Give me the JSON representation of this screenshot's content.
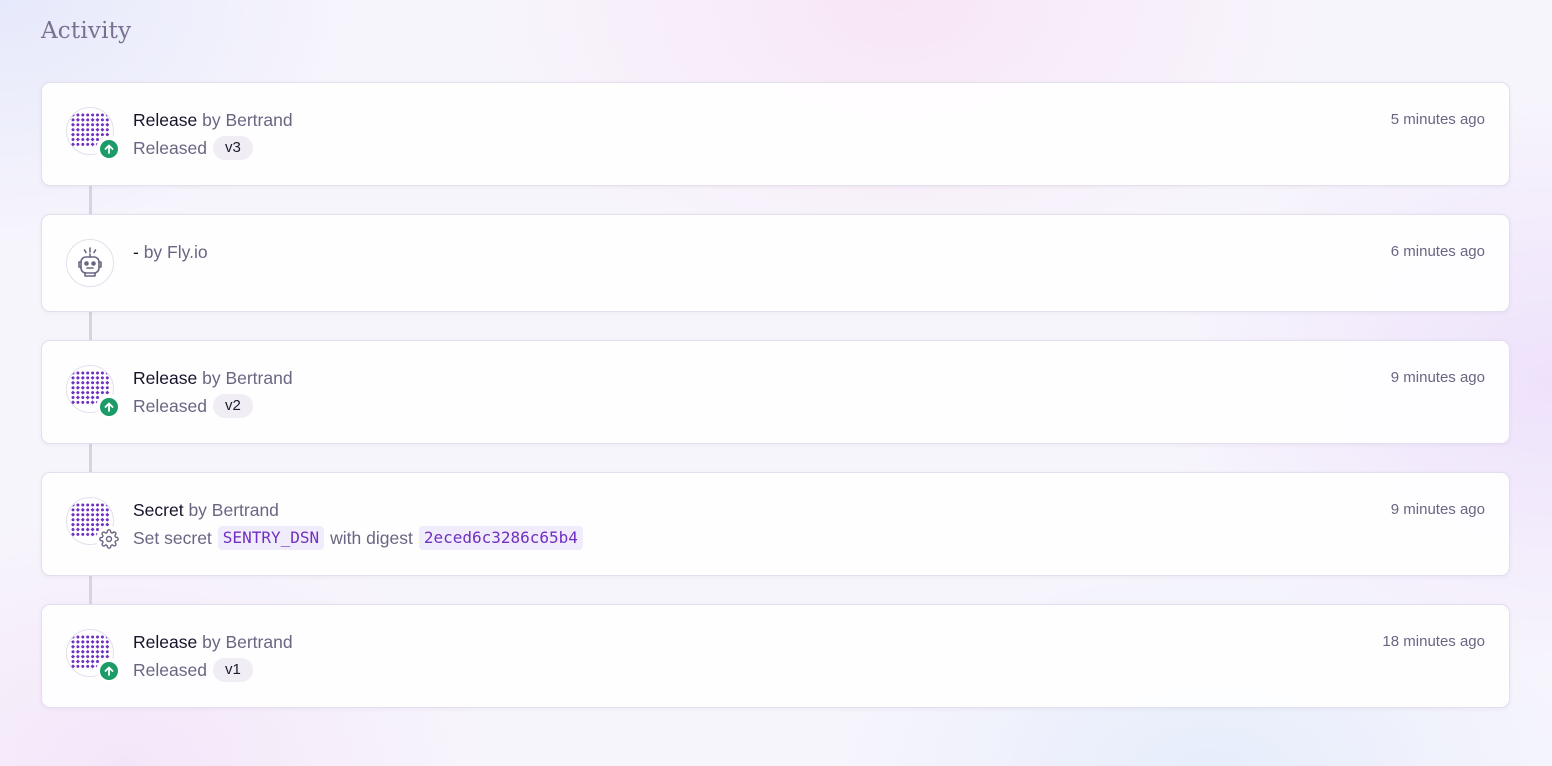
{
  "page": {
    "title": "Activity"
  },
  "colors": {
    "accent": "#7030c0",
    "release_badge": "#1a9b67"
  },
  "activities": [
    {
      "kind": "Release",
      "by": "by Bertrand",
      "detail_prefix": "Released",
      "version": "v3",
      "time": "5 minutes ago",
      "avatar": "pattern-avatar",
      "badge": "arrow-up-icon"
    },
    {
      "kind": "-",
      "by": "by Fly.io",
      "time": "6 minutes ago",
      "avatar": "robot-icon"
    },
    {
      "kind": "Release",
      "by": "by Bertrand",
      "detail_prefix": "Released",
      "version": "v2",
      "time": "9 minutes ago",
      "avatar": "pattern-avatar",
      "badge": "arrow-up-icon"
    },
    {
      "kind": "Secret",
      "by": "by Bertrand",
      "detail_prefix": "Set secret",
      "secret_name": "SENTRY_DSN",
      "detail_middle": "with digest",
      "digest": "2eced6c3286c65b4",
      "time": "9 minutes ago",
      "avatar": "pattern-avatar",
      "badge": "gear-icon"
    },
    {
      "kind": "Release",
      "by": "by Bertrand",
      "detail_prefix": "Released",
      "version": "v1",
      "time": "18 minutes ago",
      "avatar": "pattern-avatar",
      "badge": "arrow-up-icon"
    }
  ]
}
